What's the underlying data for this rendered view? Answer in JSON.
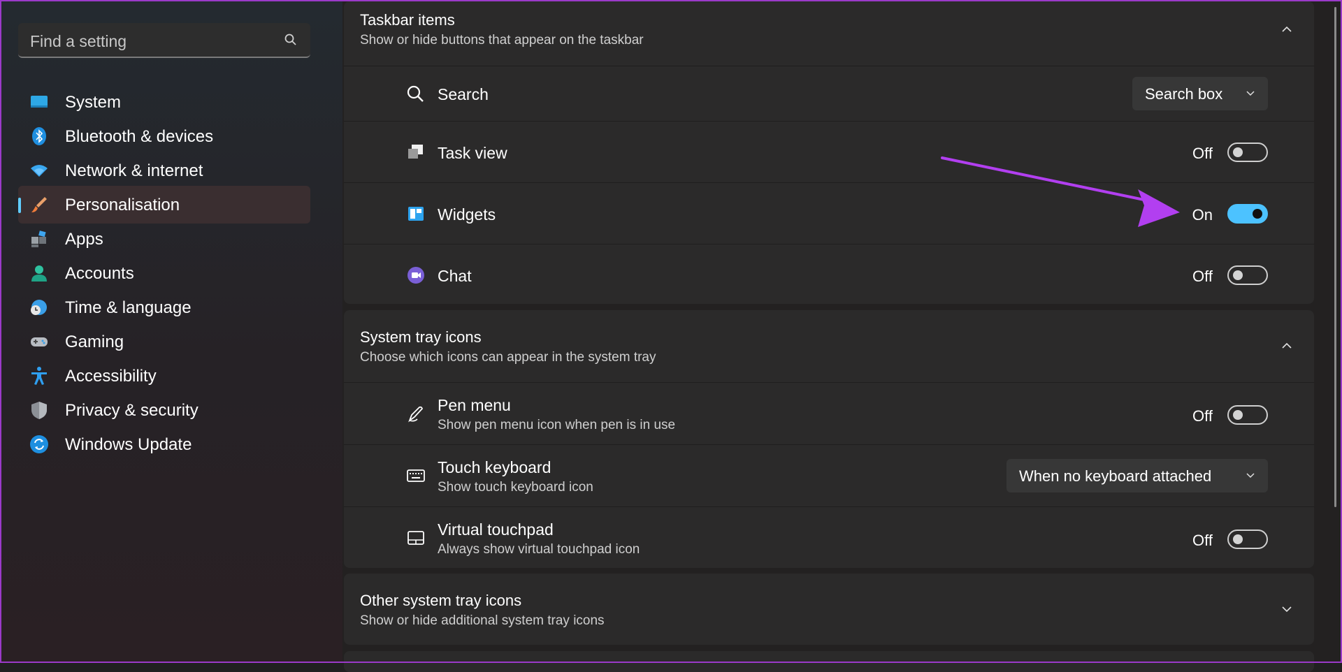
{
  "search": {
    "placeholder": "Find a setting",
    "icon": "search-icon"
  },
  "sidebar": {
    "items": [
      {
        "label": "System",
        "icon": "monitor-icon",
        "selected": false
      },
      {
        "label": "Bluetooth & devices",
        "icon": "bluetooth-icon",
        "selected": false
      },
      {
        "label": "Network & internet",
        "icon": "wifi-icon",
        "selected": false
      },
      {
        "label": "Personalisation",
        "icon": "brush-icon",
        "selected": true
      },
      {
        "label": "Apps",
        "icon": "apps-icon",
        "selected": false
      },
      {
        "label": "Accounts",
        "icon": "person-icon",
        "selected": false
      },
      {
        "label": "Time & language",
        "icon": "globe-clock-icon",
        "selected": false
      },
      {
        "label": "Gaming",
        "icon": "gamepad-icon",
        "selected": false
      },
      {
        "label": "Accessibility",
        "icon": "accessibility-icon",
        "selected": false
      },
      {
        "label": "Privacy & security",
        "icon": "shield-icon",
        "selected": false
      },
      {
        "label": "Windows Update",
        "icon": "update-icon",
        "selected": false
      }
    ]
  },
  "taskbar_items": {
    "title": "Taskbar items",
    "subtitle": "Show or hide buttons that appear on the taskbar",
    "rows": [
      {
        "label": "Search",
        "icon": "search-icon",
        "control": "dropdown",
        "value": "Search box"
      },
      {
        "label": "Task view",
        "icon": "task-view-icon",
        "control": "toggle",
        "value": "Off",
        "on": false
      },
      {
        "label": "Widgets",
        "icon": "widgets-icon",
        "control": "toggle",
        "value": "On",
        "on": true
      },
      {
        "label": "Chat",
        "icon": "chat-icon",
        "control": "toggle",
        "value": "Off",
        "on": false
      }
    ]
  },
  "system_tray": {
    "title": "System tray icons",
    "subtitle": "Choose which icons can appear in the system tray",
    "rows": [
      {
        "label": "Pen menu",
        "sub": "Show pen menu icon when pen is in use",
        "icon": "pen-icon",
        "control": "toggle",
        "value": "Off",
        "on": false
      },
      {
        "label": "Touch keyboard",
        "sub": "Show touch keyboard icon",
        "icon": "keyboard-icon",
        "control": "dropdown",
        "value": "When no keyboard attached"
      },
      {
        "label": "Virtual touchpad",
        "sub": "Always show virtual touchpad icon",
        "icon": "touchpad-icon",
        "control": "toggle",
        "value": "Off",
        "on": false
      }
    ]
  },
  "other_tray": {
    "title": "Other system tray icons",
    "subtitle": "Show or hide additional system tray icons"
  },
  "colors": {
    "accent": "#4cc2ff",
    "annotation_arrow": "#b23ff0",
    "selected_bar": "#60cdff"
  }
}
